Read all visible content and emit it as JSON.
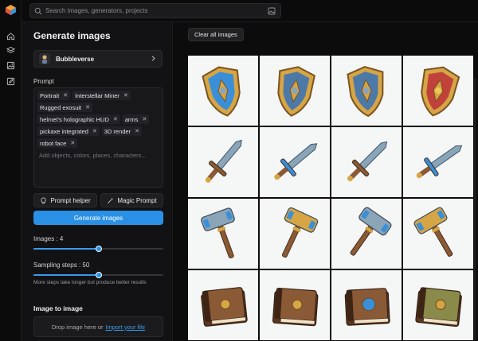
{
  "search": {
    "placeholder": "Search images, generators, projects"
  },
  "rail": {
    "icons": [
      "home-icon",
      "layers-icon",
      "image-icon",
      "edit-icon"
    ]
  },
  "panel": {
    "title": "Generate images",
    "model_name": "Bubbleverse",
    "prompt_label": "Prompt",
    "tags": [
      "Portrait",
      "Interstellar Miner",
      "Rugged exosuit",
      "helmet's holographic HUD",
      "arms",
      "pickaxe integrated",
      "3D render",
      "robot face"
    ],
    "prompt_placeholder": "Add objects, colors, places, characters...",
    "prompt_helper_label": "Prompt helper",
    "magic_prompt_label": "Magic Prompt",
    "generate_label": "Generate images",
    "images_label": "Images : 4",
    "images_value": 4,
    "images_fraction": 0.5,
    "steps_label": "Sampling steps : 50",
    "steps_value": 50,
    "steps_fraction": 0.5,
    "steps_hint": "More steps take longer but produce better results",
    "img2img_title": "Image to image",
    "dropzone_text": "Drop image here or",
    "dropzone_link": "Import your file"
  },
  "main": {
    "clear_label": "Clear all images",
    "rows": [
      [
        "shield",
        "shield",
        "shield",
        "shield"
      ],
      [
        "sword",
        "sword",
        "sword",
        "sword"
      ],
      [
        "hammer",
        "hammer",
        "hammer",
        "hammer"
      ],
      [
        "book",
        "book",
        "book",
        "book"
      ]
    ]
  },
  "colors": {
    "accent": "#2a90e6",
    "background": "#0b0b0c",
    "panel": "#121214",
    "gold": "#d6a545",
    "steel": "#8aa4b8",
    "blue": "#3a8fd8",
    "wood": "#8a5a36",
    "red": "#c0423a"
  }
}
